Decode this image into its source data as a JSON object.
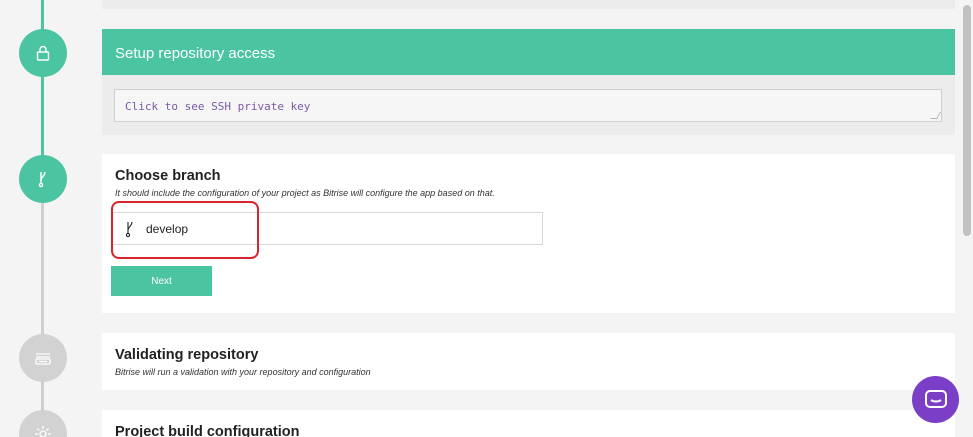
{
  "steps": {
    "repo_access": {
      "icon": "lock-icon",
      "status": "active"
    },
    "branch": {
      "icon": "branch-icon",
      "status": "active"
    },
    "validating": {
      "icon": "stack-icon",
      "status": "inactive"
    },
    "build_config": {
      "icon": "gear-icon",
      "status": "inactive"
    }
  },
  "repo_access": {
    "title": "Setup repository access",
    "ssh_placeholder": "Click to see SSH private key"
  },
  "branch": {
    "title": "Choose branch",
    "subtitle": "It should include the configuration of your project as Bitrise will configure the app based on that.",
    "value": "develop",
    "next_label": "Next"
  },
  "validating": {
    "title": "Validating repository",
    "subtitle": "Bitrise will run a validation with your repository and configuration"
  },
  "build_config": {
    "title": "Project build configuration"
  },
  "colors": {
    "accent": "#4bc4a2",
    "inactive": "#d2d2d2",
    "highlight": "#d9232c",
    "chat": "#7a3ec7"
  },
  "chat": {
    "icon": "chat-icon"
  }
}
